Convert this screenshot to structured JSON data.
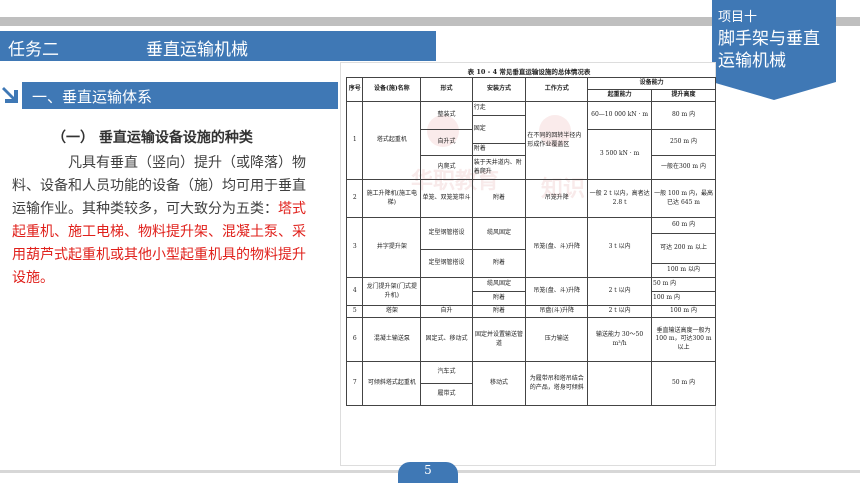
{
  "header": {
    "task_label": "任务二",
    "task_title": "垂直运输机械",
    "project_small": "项目十",
    "project_big": "脚手架与垂直运输机械"
  },
  "section": {
    "title": "一、垂直运输体系",
    "subheading": "（一） 垂直运输设备设施的种类",
    "body_plain": "凡具有垂直（竖向）提升（或降落）物料、设备和人员功能的设备（施）均可用于垂直运输作业。其种类较多，可大致分为五类：",
    "body_red": "塔式起重机、施工电梯、物料提升架、混凝土泵、采用葫芦式起重机或其他小型起重机具的物料提升设施。"
  },
  "table": {
    "caption": "表 10 - 4   常见垂直运输设施的总体情况表",
    "headers": {
      "no": "序号",
      "name": "设备(施)名称",
      "form": "形式",
      "install": "安装方式",
      "work": "工作方式",
      "capacity": "设备能力",
      "lift_weight": "起重能力",
      "lift_height": "提升高度"
    },
    "r1": {
      "no": "1",
      "name": "塔式起重机",
      "form_a": "整装式",
      "form_b": "自升式",
      "form_c": "内爬式",
      "inst_a": "行走",
      "inst_b": "固定",
      "inst_c": "附着",
      "inst_d": "装于天井道内、附着爬升",
      "work": "在不同的回转半径内形成作业覆盖区",
      "cap_a": "60—10 000 kN · m",
      "cap_b": "3 500 kN · m",
      "h_a": "80 m 内",
      "h_b": "250 m 内",
      "h_c": "一般在300 m 内"
    },
    "r2": {
      "no": "2",
      "name": "施工升降机(施工电梯)",
      "form": "单笼、双笼笼带斗",
      "install": "附着",
      "work": "吊笼升降",
      "cap": "一般 2 t 以内，高者达 2.8 t",
      "height": "一般 100 m 内，最高已达 645 m"
    },
    "r3": {
      "no": "3",
      "name": "井字提升架",
      "form_a": "定型钢管搭设",
      "form_b": "定型钢管搭设",
      "inst_a": "缆风固定",
      "inst_b": "附着",
      "work": "吊笼(盘、斗)升降",
      "cap": "3 t 以内",
      "h_a": "60 m 内",
      "h_b": "可达 200 m 以上",
      "h_c": "100 m 以内"
    },
    "r4": {
      "no": "4",
      "name": "龙门提升架(门式提升机)",
      "inst_a": "缆风固定",
      "inst_b": "附着",
      "work": "吊笼(盘、斗)升降",
      "cap": "2 t 以内",
      "h_a": "50 m 内",
      "h_b": "100 m 内"
    },
    "r5": {
      "no": "5",
      "name": "塔架",
      "form": "自升",
      "install": "附着",
      "work": "吊盘(斗)升降",
      "cap": "2 t 以内",
      "height": "100 m 内"
    },
    "r6": {
      "no": "6",
      "name": "混凝土输送泵",
      "form": "固定式、移动式",
      "install": "固定并设置输送管道",
      "work": "压力输送",
      "cap": "输送能力 30～50 m³/h",
      "height": "垂直输送高度一般为100 m，可达300 m 以上"
    },
    "r7": {
      "no": "7",
      "name": "可倾斜塔式起重机",
      "form_a": "汽车式",
      "form_b": "履带式",
      "install": "移动式",
      "work": "为履带吊和塔吊结合的产品，塔身可倾斜",
      "height": "50 m 内"
    }
  },
  "footer": {
    "page": "5"
  },
  "colors": {
    "accent": "#3f78b5",
    "highlight": "#e0201b"
  }
}
